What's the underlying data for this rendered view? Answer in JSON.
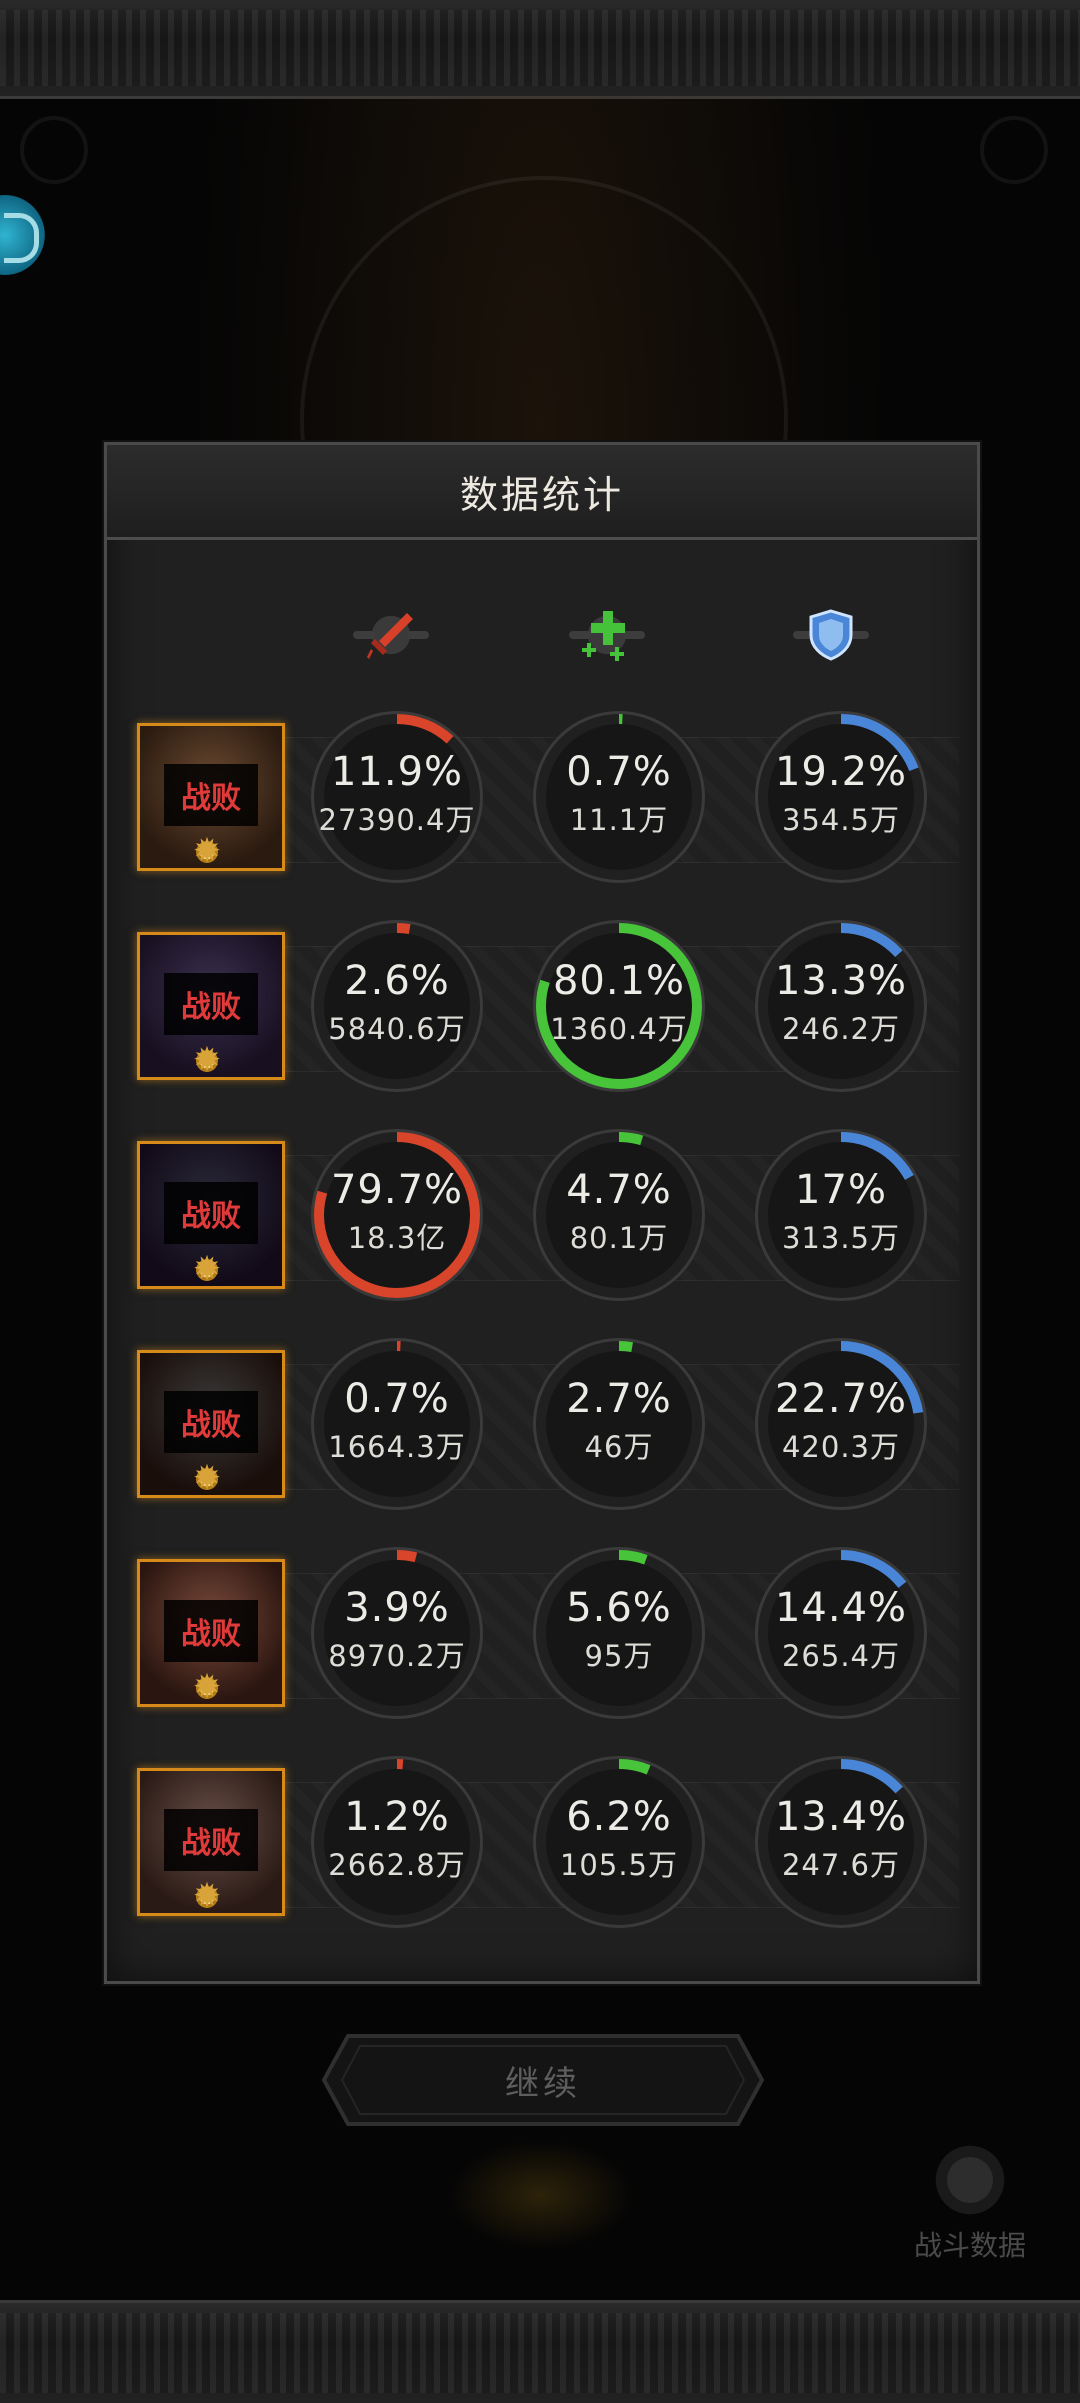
{
  "dialog": {
    "title": "数据统计",
    "columns": [
      {
        "icon": "sword-icon",
        "color": "#d9402a",
        "label": "damage"
      },
      {
        "icon": "heal-cross-icon",
        "color": "#45c23a",
        "label": "healing"
      },
      {
        "icon": "shield-icon",
        "color": "#4a86d8",
        "label": "damage-taken"
      }
    ],
    "rows": [
      {
        "status": "战败",
        "damage": {
          "pct": "11.9%",
          "amount": "27390.4万",
          "fraction": 0.119
        },
        "heal": {
          "pct": "0.7%",
          "amount": "11.1万",
          "fraction": 0.007
        },
        "tank": {
          "pct": "19.2%",
          "amount": "354.5万",
          "fraction": 0.192
        }
      },
      {
        "status": "战败",
        "damage": {
          "pct": "2.6%",
          "amount": "5840.6万",
          "fraction": 0.026
        },
        "heal": {
          "pct": "80.1%",
          "amount": "1360.4万",
          "fraction": 0.801
        },
        "tank": {
          "pct": "13.3%",
          "amount": "246.2万",
          "fraction": 0.133
        }
      },
      {
        "status": "战败",
        "damage": {
          "pct": "79.7%",
          "amount": "18.3亿",
          "fraction": 0.797
        },
        "heal": {
          "pct": "4.7%",
          "amount": "80.1万",
          "fraction": 0.047
        },
        "tank": {
          "pct": "17%",
          "amount": "313.5万",
          "fraction": 0.17
        }
      },
      {
        "status": "战败",
        "damage": {
          "pct": "0.7%",
          "amount": "1664.3万",
          "fraction": 0.007
        },
        "heal": {
          "pct": "2.7%",
          "amount": "46万",
          "fraction": 0.027
        },
        "tank": {
          "pct": "22.7%",
          "amount": "420.3万",
          "fraction": 0.227
        }
      },
      {
        "status": "战败",
        "damage": {
          "pct": "3.9%",
          "amount": "8970.2万",
          "fraction": 0.039
        },
        "heal": {
          "pct": "5.6%",
          "amount": "95万",
          "fraction": 0.056
        },
        "tank": {
          "pct": "14.4%",
          "amount": "265.4万",
          "fraction": 0.144
        }
      },
      {
        "status": "战败",
        "damage": {
          "pct": "1.2%",
          "amount": "2662.8万",
          "fraction": 0.012
        },
        "heal": {
          "pct": "6.2%",
          "amount": "105.5万",
          "fraction": 0.062
        },
        "tank": {
          "pct": "13.4%",
          "amount": "247.6万",
          "fraction": 0.134
        }
      }
    ]
  },
  "continue_label": "继续",
  "battle_data_label": "战斗数据",
  "colors": {
    "damage": "#d9452b",
    "heal": "#47c43a",
    "tank": "#4a86d8",
    "portrait_border": "#d68a1a",
    "status": "#e03a3a"
  }
}
